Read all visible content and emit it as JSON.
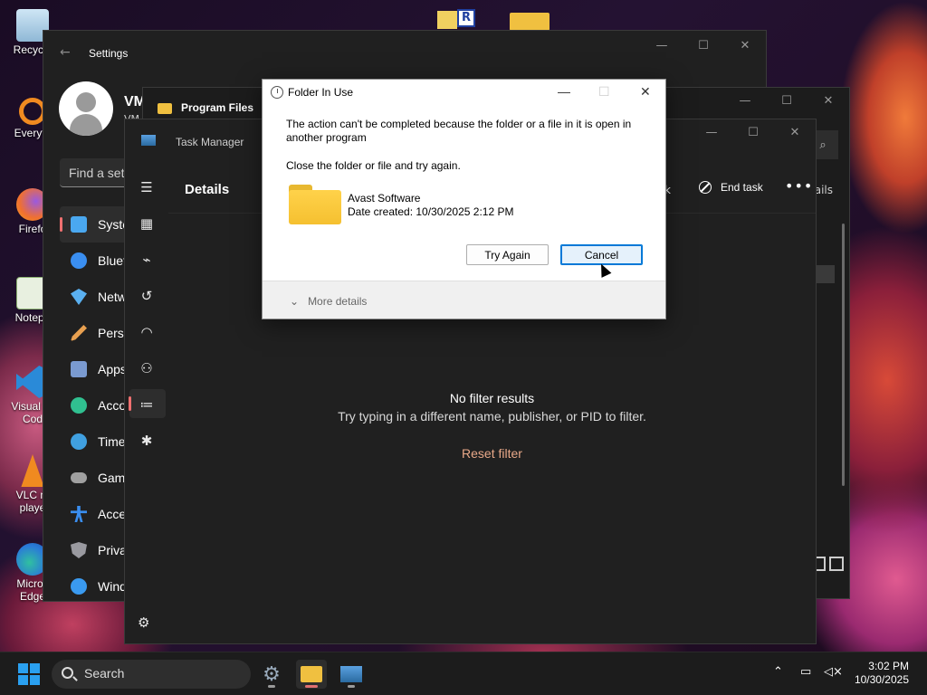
{
  "desktop": {
    "icons": [
      {
        "label": "Recycle",
        "icon": "recycle-bin-icon"
      },
      {
        "label": "Everyth",
        "icon": "everything-search-icon"
      },
      {
        "label": "Firefo",
        "icon": "firefox-icon"
      },
      {
        "label": "Notepa",
        "icon": "notepad-icon"
      },
      {
        "label": "Visual St Cod",
        "icon": "vscode-icon"
      },
      {
        "label": "VLC m playe",
        "icon": "vlc-icon"
      },
      {
        "label": "Micros Edge",
        "icon": "edge-icon"
      }
    ]
  },
  "settings": {
    "title": "Settings",
    "user_name": "VM",
    "user_sub": "VM",
    "find_placeholder": "Find a setti",
    "nav": [
      {
        "label": "Syste",
        "icon": "system-icon",
        "color": "#4aa8f0",
        "active": true
      },
      {
        "label": "Bluet",
        "icon": "bluetooth-icon",
        "color": "#3a8ef0"
      },
      {
        "label": "Netw",
        "icon": "wifi-icon",
        "color": "#5ab0f0"
      },
      {
        "label": "Perso",
        "icon": "brush-icon",
        "color": "#e8a050"
      },
      {
        "label": "Apps",
        "icon": "apps-icon",
        "color": "#7a9ad0"
      },
      {
        "label": "Acco",
        "icon": "accounts-icon",
        "color": "#30c090"
      },
      {
        "label": "Time",
        "icon": "time-language-icon",
        "color": "#40a0e0"
      },
      {
        "label": "Gam",
        "icon": "gaming-icon",
        "color": "#a0a0a0"
      },
      {
        "label": "Acce",
        "icon": "accessibility-icon",
        "color": "#3a8ef0"
      },
      {
        "label": "Priva",
        "icon": "shield-icon",
        "color": "#9a9aa0"
      },
      {
        "label": "Wind",
        "icon": "windows-update-icon",
        "color": "#3a9af0"
      }
    ]
  },
  "explorer": {
    "tab_title": "Program Files",
    "right_fragment": "ails"
  },
  "taskmgr": {
    "title": "Task Manager",
    "page_title": "Details",
    "toolbar_fragment": "k",
    "end_task": "End task",
    "more": "•••",
    "empty_title": "No filter results",
    "empty_sub": "Try typing in a different name, publisher, or PID to filter.",
    "reset": "Reset filter"
  },
  "dialog": {
    "title": "Folder In Use",
    "message": "The action can't be completed because the folder or a file in it is open in another program",
    "message2": "Close the folder or file and try again.",
    "folder_name": "Avast Software",
    "folder_date": "Date created: 10/30/2025 2:12 PM",
    "try_again": "Try Again",
    "cancel": "Cancel",
    "more_details": "More details"
  },
  "taskbar": {
    "search": "Search",
    "time": "3:02 PM",
    "date": "10/30/2025"
  }
}
